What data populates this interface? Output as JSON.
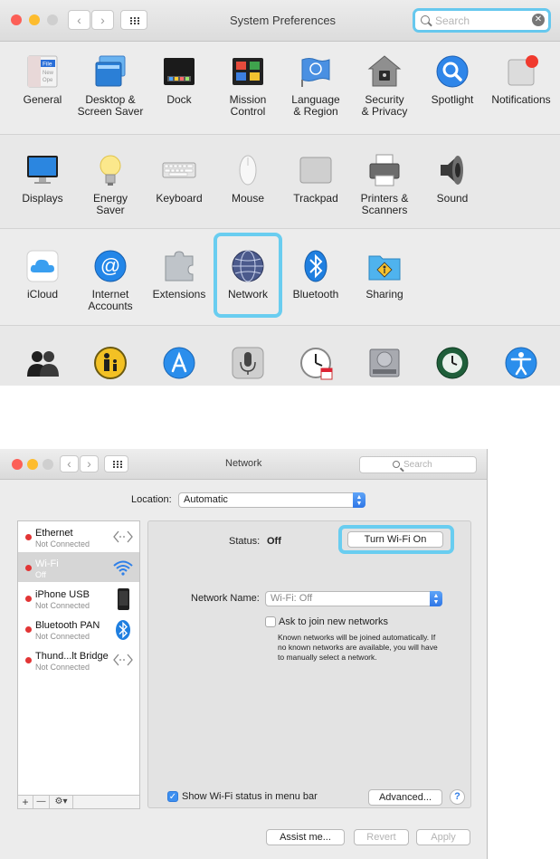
{
  "system_preferences": {
    "title": "System Preferences",
    "search": {
      "placeholder": "Search",
      "clear_icon": "clear-icon"
    },
    "rows": [
      [
        {
          "label": "General",
          "icon": "general-icon"
        },
        {
          "label": "Desktop &\nScreen Saver",
          "icon": "desktop-icon"
        },
        {
          "label": "Dock",
          "icon": "dock-icon"
        },
        {
          "label": "Mission\nControl",
          "icon": "mission-control-icon"
        },
        {
          "label": "Language\n& Region",
          "icon": "flag-icon"
        },
        {
          "label": "Security\n& Privacy",
          "icon": "house-lock-icon"
        },
        {
          "label": "Spotlight",
          "icon": "spotlight-icon"
        },
        {
          "label": "Notifications",
          "icon": "notifications-icon"
        }
      ],
      [
        {
          "label": "Displays",
          "icon": "display-icon"
        },
        {
          "label": "Energy\nSaver",
          "icon": "bulb-icon"
        },
        {
          "label": "Keyboard",
          "icon": "keyboard-icon"
        },
        {
          "label": "Mouse",
          "icon": "mouse-icon"
        },
        {
          "label": "Trackpad",
          "icon": "trackpad-icon"
        },
        {
          "label": "Printers &\nScanners",
          "icon": "printer-icon"
        },
        {
          "label": "Sound",
          "icon": "speaker-icon"
        }
      ],
      [
        {
          "label": "iCloud",
          "icon": "cloud-icon"
        },
        {
          "label": "Internet\nAccounts",
          "icon": "at-icon"
        },
        {
          "label": "Extensions",
          "icon": "puzzle-icon"
        },
        {
          "label": "Network",
          "icon": "globe-icon"
        },
        {
          "label": "Bluetooth",
          "icon": "bluetooth-icon"
        },
        {
          "label": "Sharing",
          "icon": "sharing-folder-icon"
        }
      ],
      [
        {
          "label": "",
          "icon": "users-icon"
        },
        {
          "label": "",
          "icon": "parental-controls-icon"
        },
        {
          "label": "",
          "icon": "app-store-icon"
        },
        {
          "label": "",
          "icon": "microphone-icon"
        },
        {
          "label": "",
          "icon": "date-time-icon"
        },
        {
          "label": "",
          "icon": "startup-disk-icon"
        },
        {
          "label": "",
          "icon": "time-machine-icon"
        },
        {
          "label": "",
          "icon": "accessibility-icon"
        }
      ]
    ],
    "highlighted_pane": "Network"
  },
  "network": {
    "title": "Network",
    "search": {
      "placeholder": "Search"
    },
    "location": {
      "label": "Location:",
      "value": "Automatic"
    },
    "services": [
      {
        "name": "Ethernet",
        "status": "Not Connected",
        "icon": "ethernet-icon",
        "selected": false
      },
      {
        "name": "Wi-Fi",
        "status": "Off",
        "icon": "wifi-icon",
        "selected": true
      },
      {
        "name": "iPhone USB",
        "status": "Not Connected",
        "icon": "iphone-icon",
        "selected": false
      },
      {
        "name": "Bluetooth PAN",
        "status": "Not Connected",
        "icon": "bluetooth-icon",
        "selected": false
      },
      {
        "name": "Thund...lt Bridge",
        "status": "Not Connected",
        "icon": "ethernet-icon",
        "selected": false
      }
    ],
    "list_tools": {
      "add": "+",
      "remove": "—",
      "action": "⚙▾"
    },
    "status": {
      "label": "Status:",
      "value": "Off"
    },
    "turn_wifi_on": "Turn Wi-Fi On",
    "network_name": {
      "label": "Network Name:",
      "value": "Wi-Fi: Off"
    },
    "ask_to_join": {
      "label": "Ask to join new networks",
      "checked": false,
      "note": [
        "Known networks will be joined automatically. If",
        "no known networks are available, you will have",
        "to manually select a network."
      ]
    },
    "show_status": {
      "label": "Show Wi-Fi status in menu bar",
      "checked": true
    },
    "advanced": "Advanced...",
    "help": "?",
    "assist_me": "Assist me...",
    "revert": "Revert",
    "apply": "Apply"
  },
  "colors": {
    "highlight": "#69cdf0",
    "status_dot": "#e23535",
    "accent": "#3d8ff0"
  }
}
